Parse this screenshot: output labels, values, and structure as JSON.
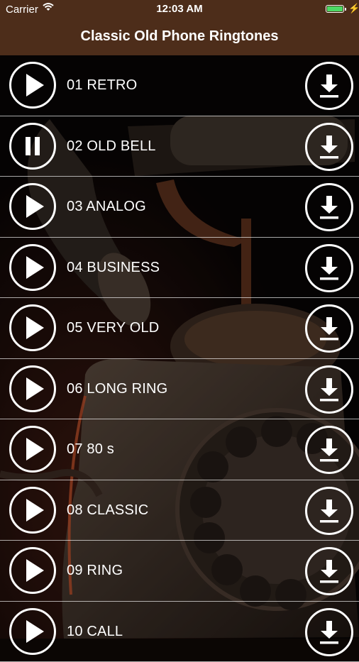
{
  "status_bar": {
    "carrier": "Carrier",
    "time": "12:03 AM",
    "battery_level": 1.0
  },
  "nav": {
    "title": "Classic Old Phone Ringtones"
  },
  "colors": {
    "header_bg": "#4d2d1a",
    "battery_fill": "#4cd964",
    "icon_stroke": "#ffffff"
  },
  "ringtones": [
    {
      "label": "01 RETRO",
      "state": "stopped",
      "play_icon": "play-icon",
      "download_icon": "download-icon"
    },
    {
      "label": "02 OLD BELL",
      "state": "playing",
      "play_icon": "pause-icon",
      "download_icon": "download-icon"
    },
    {
      "label": "03 ANALOG",
      "state": "stopped",
      "play_icon": "play-icon",
      "download_icon": "download-icon"
    },
    {
      "label": "04 BUSINESS",
      "state": "stopped",
      "play_icon": "play-icon",
      "download_icon": "download-icon"
    },
    {
      "label": "05 VERY OLD",
      "state": "stopped",
      "play_icon": "play-icon",
      "download_icon": "download-icon"
    },
    {
      "label": "06 LONG RING",
      "state": "stopped",
      "play_icon": "play-icon",
      "download_icon": "download-icon"
    },
    {
      "label": "07 80 s",
      "state": "stopped",
      "play_icon": "play-icon",
      "download_icon": "download-icon"
    },
    {
      "label": "08 CLASSIC",
      "state": "stopped",
      "play_icon": "play-icon",
      "download_icon": "download-icon"
    },
    {
      "label": "09 RING",
      "state": "stopped",
      "play_icon": "play-icon",
      "download_icon": "download-icon"
    },
    {
      "label": "10 CALL",
      "state": "stopped",
      "play_icon": "play-icon",
      "download_icon": "download-icon"
    }
  ]
}
